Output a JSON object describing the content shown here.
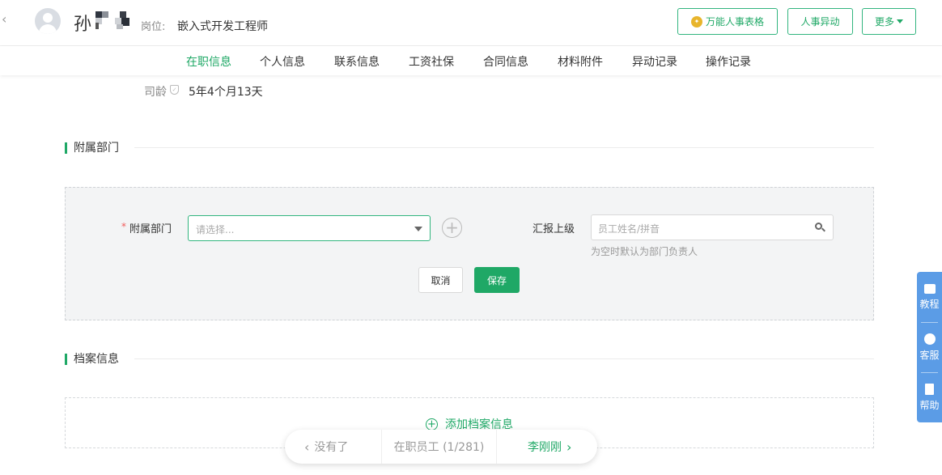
{
  "header": {
    "name_initial": "孙",
    "post_label": "岗位:",
    "post_value": "嵌入式开发工程师",
    "btn_table": "万能人事表格",
    "btn_change": "人事异动",
    "btn_more": "更多"
  },
  "tabs": [
    "在职信息",
    "个人信息",
    "联系信息",
    "工资社保",
    "合同信息",
    "材料附件",
    "异动记录",
    "操作记录"
  ],
  "active_tab": "在职信息",
  "seniority": {
    "label": "司龄",
    "value": "5年4个月13天"
  },
  "sections": {
    "dept": "附属部门",
    "archive": "档案信息"
  },
  "dept_form": {
    "required_mark": "*",
    "dept_label": "附属部门",
    "dept_placeholder": "请选择...",
    "report_label": "汇报上级",
    "report_placeholder": "员工姓名/拼音",
    "report_hint": "为空时默认为部门负责人",
    "cancel": "取消",
    "save": "保存"
  },
  "archive": {
    "add_label": "添加档案信息"
  },
  "pager": {
    "prev": "没有了",
    "position": "在职员工 (1/281)",
    "next": "李刚刚"
  },
  "side": {
    "tutorial": "教程",
    "service": "客服",
    "help": "帮助"
  },
  "colors": {
    "accent": "#1fa866",
    "side_panel": "#5b9ce6",
    "required": "#f25a5a"
  },
  "icons": [
    "chevron-left-icon",
    "avatar-icon",
    "gear-icon",
    "caret-down-icon",
    "shield-icon",
    "plus-circle-icon",
    "search-icon",
    "chat-icon",
    "doc-icon",
    "id-card-icon",
    "chevron-right-icon"
  ]
}
